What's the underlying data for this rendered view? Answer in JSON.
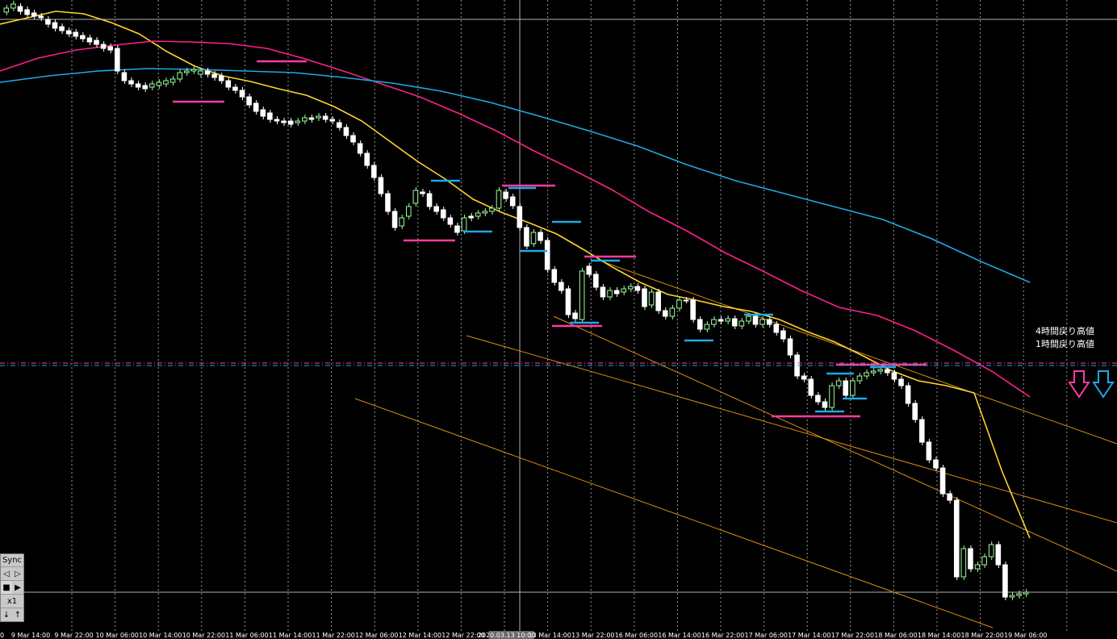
{
  "chart_data": {
    "type": "candlestick",
    "x_ticks": [
      "9 Mar 14:00",
      "9 Mar 22:00",
      "10 Mar 06:00",
      "10 Mar 14:00",
      "10 Mar 22:00",
      "11 Mar 06:00",
      "11 Mar 14:00",
      "11 Mar 22:00",
      "12 Mar 06:00",
      "12 Mar 14:00",
      "12 Mar 22:00",
      "2020.03.13 10:00",
      "13 Mar 14:00",
      "13 Mar 22:00",
      "16 Mar 06:00",
      "16 Mar 14:00",
      "16 Mar 22:00",
      "17 Mar 06:00",
      "17 Mar 14:00",
      "17 Mar 22:00",
      "18 Mar 06:00",
      "18 Mar 14:00",
      "18 Mar 22:00",
      "19 Mar 06:00"
    ],
    "first_tick_fragment": "0",
    "highlighted_tick": "2020.03.13 10:00",
    "annotations": [
      "4時間戻り高値",
      "1時間戻り高値"
    ],
    "moving_averages": [
      {
        "color": "#ffd42a",
        "values": [
          30,
          22,
          14,
          17,
          28,
          42,
          64,
          82,
          94,
          101,
          110,
          118,
          132,
          150,
          175,
          200,
          222,
          247,
          263,
          276,
          290,
          310,
          331,
          350,
          365,
          372,
          380,
          386,
          396,
          411,
          424,
          441,
          459,
          472,
          478,
          487,
          584,
          667
        ]
      },
      {
        "color": "#ff1f8c",
        "values": [
          88,
          72,
          62,
          56,
          51,
          52,
          54,
          60,
          73,
          88,
          104,
          120,
          140,
          162,
          187,
          210,
          234,
          262,
          286,
          313,
          336,
          360,
          381,
          391,
          410,
          434,
          460,
          492
        ]
      },
      {
        "color": "#1ea8e6",
        "values": [
          102,
          94,
          88,
          85,
          86,
          88,
          90,
          96,
          103,
          113,
          127,
          144,
          162,
          181,
          204,
          224,
          240,
          256,
          272,
          296,
          324,
          350
        ]
      }
    ],
    "series": [
      {
        "values_open_close": [
          [
            15,
            10
          ],
          [
            10,
            5
          ],
          [
            8,
            14
          ],
          [
            12,
            18
          ],
          [
            16,
            20
          ],
          [
            20,
            22
          ],
          [
            24,
            30
          ],
          [
            28,
            35
          ],
          [
            33,
            38
          ],
          [
            38,
            42
          ],
          [
            40,
            45
          ],
          [
            44,
            48
          ],
          [
            47,
            52
          ],
          [
            50,
            55
          ],
          [
            55,
            60
          ],
          [
            58,
            62
          ],
          [
            60,
            88
          ],
          [
            90,
            100
          ],
          [
            100,
            104
          ],
          [
            104,
            108
          ],
          [
            106,
            110
          ],
          [
            108,
            104
          ],
          [
            106,
            102
          ],
          [
            104,
            100
          ],
          [
            102,
            98
          ],
          [
            98,
            90
          ],
          [
            90,
            88
          ],
          [
            88,
            86
          ],
          [
            92,
            88
          ],
          [
            88,
            92
          ],
          [
            92,
            96
          ],
          [
            94,
            100
          ],
          [
            100,
            108
          ],
          [
            108,
            112
          ],
          [
            112,
            120
          ],
          [
            120,
            130
          ],
          [
            128,
            138
          ],
          [
            136,
            144
          ],
          [
            140,
            148
          ],
          [
            148,
            150
          ],
          [
            150,
            152
          ],
          [
            150,
            154
          ],
          [
            152,
            150
          ],
          [
            150,
            146
          ],
          [
            146,
            148
          ],
          [
            146,
            144
          ],
          [
            144,
            148
          ],
          [
            148,
            150
          ],
          [
            152,
            158
          ],
          [
            158,
            168
          ],
          [
            168,
            176
          ],
          [
            178,
            190
          ],
          [
            190,
            205
          ],
          [
            205,
            220
          ],
          [
            220,
            240
          ],
          [
            240,
            262
          ],
          [
            262,
            282
          ],
          [
            280,
            270
          ],
          [
            268,
            256
          ],
          [
            252,
            236
          ],
          [
            238,
            240
          ],
          [
            240,
            256
          ],
          [
            256,
            262
          ],
          [
            260,
            270
          ],
          [
            270,
            278
          ],
          [
            280,
            288
          ],
          [
            286,
            270
          ],
          [
            268,
            270
          ],
          [
            268,
            264
          ],
          [
            264,
            262
          ],
          [
            262,
            258
          ],
          [
            258,
            236
          ],
          [
            238,
            246
          ],
          [
            244,
            255
          ],
          [
            256,
            282
          ],
          [
            282,
            305
          ],
          [
            302,
            288
          ],
          [
            288,
            298
          ],
          [
            298,
            334
          ],
          [
            334,
            350
          ],
          [
            350,
            360
          ],
          [
            358,
            390
          ],
          [
            388,
            395
          ],
          [
            396,
            336
          ],
          [
            330,
            340
          ],
          [
            340,
            356
          ],
          [
            356,
            368
          ],
          [
            368,
            360
          ],
          [
            360,
            364
          ],
          [
            362,
            358
          ],
          [
            358,
            355
          ],
          [
            355,
            360
          ],
          [
            358,
            380
          ],
          [
            378,
            362
          ],
          [
            362,
            385
          ],
          [
            385,
            392
          ],
          [
            392,
            382
          ],
          [
            382,
            372
          ],
          [
            372,
            372
          ],
          [
            372,
            396
          ],
          [
            396,
            408
          ],
          [
            408,
            402
          ],
          [
            402,
            396
          ],
          [
            396,
            398
          ],
          [
            398,
            395
          ],
          [
            395,
            404
          ],
          [
            404,
            398
          ],
          [
            398,
            392
          ],
          [
            392,
            402
          ],
          [
            402,
            396
          ],
          [
            396,
            402
          ],
          [
            402,
            412
          ],
          [
            410,
            420
          ],
          [
            420,
            440
          ],
          [
            440,
            466
          ],
          [
            466,
            470
          ],
          [
            470,
            490
          ],
          [
            490,
            498
          ],
          [
            498,
            505
          ],
          [
            505,
            478
          ],
          [
            478,
            472
          ],
          [
            472,
            490
          ],
          [
            490,
            472
          ],
          [
            472,
            466
          ],
          [
            466,
            462
          ],
          [
            462,
            460
          ],
          [
            460,
            458
          ],
          [
            458,
            462
          ],
          [
            462,
            470
          ],
          [
            470,
            478
          ],
          [
            478,
            500
          ],
          [
            500,
            520
          ],
          [
            520,
            548
          ],
          [
            548,
            570
          ],
          [
            570,
            580
          ],
          [
            580,
            612
          ],
          [
            612,
            620
          ],
          [
            620,
            715
          ],
          [
            715,
            680
          ],
          [
            680,
            705
          ],
          [
            705,
            700
          ],
          [
            700,
            690
          ],
          [
            690,
            675
          ],
          [
            675,
            700
          ],
          [
            700,
            740
          ],
          [
            740,
            738
          ],
          [
            738,
            736
          ],
          [
            736,
            734
          ]
        ]
      }
    ]
  },
  "panel": {
    "sync_label": "Sync",
    "zoom_label": "x1"
  },
  "colors": {
    "ma_fast": "#ffd42a",
    "ma_mid": "#ff1f8c",
    "ma_slow": "#1ea8e6",
    "bull": "#9dff9d",
    "bear": "#ffffff",
    "channel": "#d98b12",
    "arrow_magenta": "#ff3ca4",
    "arrow_blue": "#1ea8e6"
  }
}
